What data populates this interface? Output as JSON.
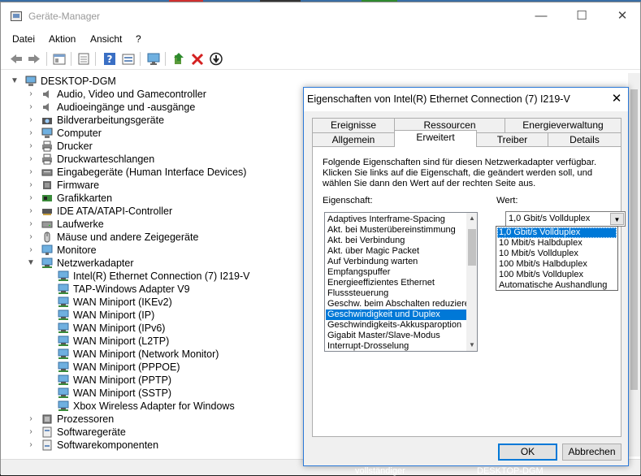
{
  "window": {
    "title": "Geräte-Manager",
    "minimize_glyph": "—",
    "maximize_glyph": "☐",
    "close_glyph": "✕"
  },
  "menu": [
    "Datei",
    "Aktion",
    "Ansicht",
    "?"
  ],
  "toolbar_icons": [
    "back-arrow-icon",
    "forward-arrow-icon",
    "properties-icon",
    "show-hidden-icon",
    "help-icon",
    "view-icon",
    "monitor-icon",
    "update-driver-icon",
    "uninstall-icon",
    "disable-icon"
  ],
  "tree": {
    "root": "DESKTOP-DGM",
    "categories": [
      {
        "label": "Audio, Video und Gamecontroller",
        "icon": "speaker-icon"
      },
      {
        "label": "Audioeingänge und -ausgänge",
        "icon": "speaker-icon"
      },
      {
        "label": "Bildverarbeitungsgeräte",
        "icon": "camera-icon"
      },
      {
        "label": "Computer",
        "icon": "computer-icon"
      },
      {
        "label": "Drucker",
        "icon": "printer-icon"
      },
      {
        "label": "Druckwarteschlangen",
        "icon": "printer-icon"
      },
      {
        "label": "Eingabegeräte (Human Interface Devices)",
        "icon": "hid-icon"
      },
      {
        "label": "Firmware",
        "icon": "chip-icon"
      },
      {
        "label": "Grafikkarten",
        "icon": "display-adapter-icon"
      },
      {
        "label": "IDE ATA/ATAPI-Controller",
        "icon": "ide-controller-icon"
      },
      {
        "label": "Laufwerke",
        "icon": "disk-drive-icon"
      },
      {
        "label": "Mäuse und andere Zeigegeräte",
        "icon": "mouse-icon"
      },
      {
        "label": "Monitore",
        "icon": "monitor-icon"
      },
      {
        "label": "Netzwerkadapter",
        "icon": "network-adapter-icon"
      }
    ],
    "network_children": [
      "Intel(R) Ethernet Connection (7) I219-V",
      "TAP-Windows Adapter V9",
      "WAN Miniport (IKEv2)",
      "WAN Miniport (IP)",
      "WAN Miniport (IPv6)",
      "WAN Miniport (L2TP)",
      "WAN Miniport (Network Monitor)",
      "WAN Miniport (PPPOE)",
      "WAN Miniport (PPTP)",
      "WAN Miniport (SSTP)",
      "Xbox Wireless Adapter for Windows"
    ],
    "after": [
      {
        "label": "Prozessoren",
        "icon": "cpu-icon"
      },
      {
        "label": "Softwaregeräte",
        "icon": "software-device-icon"
      },
      {
        "label": "Softwarekomponenten",
        "icon": "software-component-icon"
      }
    ]
  },
  "status_below": {
    "left": "vollständiger",
    "right": "DESKTOP-DGM"
  },
  "dialog": {
    "title": "Eigenschaften von Intel(R) Ethernet Connection (7) I219-V",
    "close_glyph": "✕",
    "tabs_row1": [
      "Ereignisse",
      "Ressourcen",
      "Energieverwaltung"
    ],
    "tabs_row2": [
      "Allgemein",
      "Erweitert",
      "Treiber",
      "Details"
    ],
    "active_tab": "Erweitert",
    "description": "Folgende Eigenschaften sind für diesen Netzwerkadapter verfügbar. Klicken Sie links auf die Eigenschaft, die geändert werden soll, und wählen Sie dann den Wert auf der rechten Seite aus.",
    "property_label": "Eigenschaft:",
    "value_label": "Wert:",
    "properties": [
      "Adaptives Interframe-Spacing",
      "Akt. bei Musterübereinstimmung",
      "Akt. bei Verbindung",
      "Akt. über Magic Packet",
      "Auf Verbindung warten",
      "Empfangspuffer",
      "Energieeffizientes Ethernet",
      "Flusssteuerung",
      "Geschw. beim Abschalten reduzieren",
      "Geschwindigkeit und Duplex",
      "Geschwindigkeits-Akkusparoption",
      "Gigabit Master/Slave-Modus",
      "Interrupt-Drosselung"
    ],
    "selected_property": "Geschwindigkeit und Duplex",
    "value_current": "1,0 Gbit/s Vollduplex",
    "value_options": [
      "1,0 Gbit/s Vollduplex",
      "10 Mbit/s Halbduplex",
      "10 Mbit/s Vollduplex",
      "100 Mbit/s Halbduplex",
      "100 Mbit/s Vollduplex",
      "Automatische Aushandlung"
    ],
    "ok_label": "OK",
    "cancel_label": "Abbrechen"
  },
  "colors": {
    "selection": "#0078d7",
    "dialog_border": "#2b79d8",
    "tree_selection": "#cce8ff"
  }
}
